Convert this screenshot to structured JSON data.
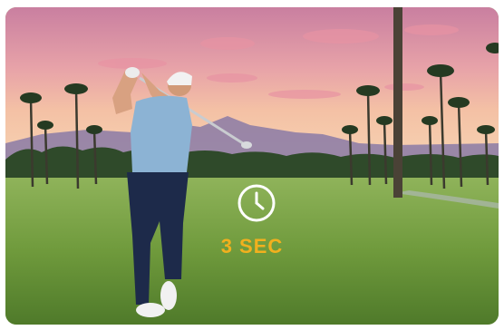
{
  "photo": {
    "subject": "golfer",
    "icon": "clock-icon"
  },
  "overlay": {
    "timer_label": "3 SEC",
    "accent_color": "#f2b01e"
  }
}
